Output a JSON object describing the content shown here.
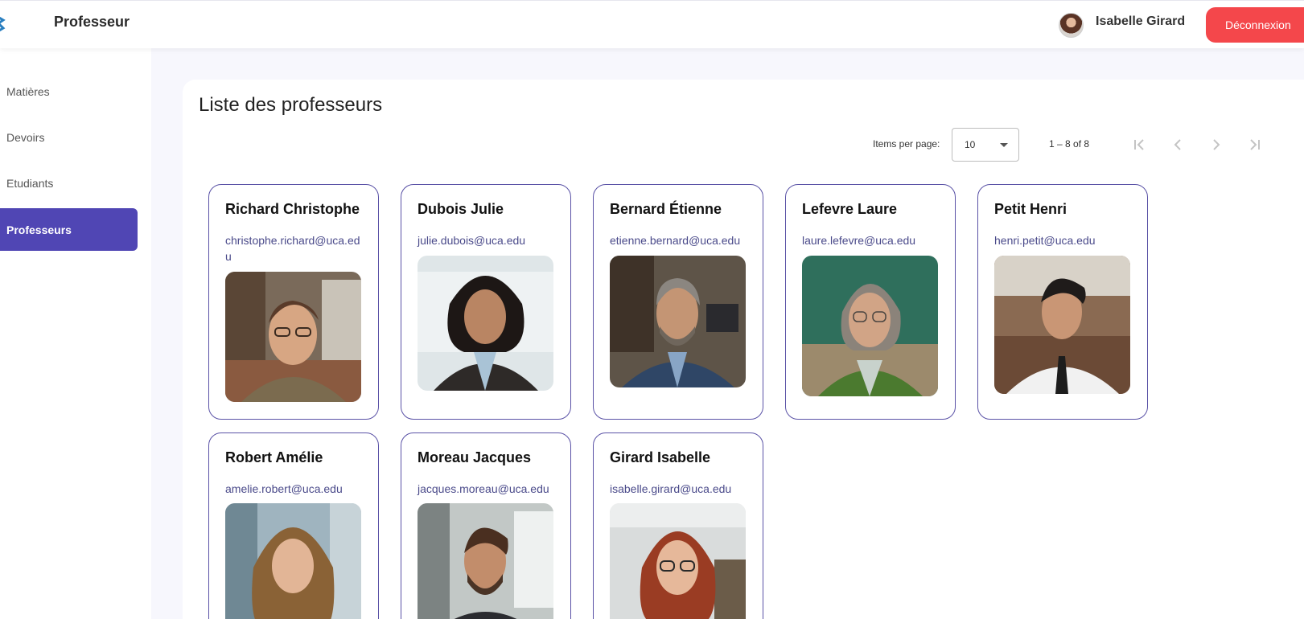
{
  "header": {
    "app_title": "Professeur",
    "user_name": "Isabelle Girard",
    "logout_label": "Déconnexion"
  },
  "sidebar": {
    "items": [
      {
        "label": "Matières",
        "active": false
      },
      {
        "label": "Devoirs",
        "active": false
      },
      {
        "label": "Etudiants",
        "active": false
      },
      {
        "label": "Professeurs",
        "active": true
      }
    ]
  },
  "main": {
    "title": "Liste des professeurs",
    "paginator": {
      "items_per_page_label": "Items per page:",
      "items_per_page_value": "10",
      "range_label": "1 – 8 of 8"
    },
    "professors": [
      {
        "name": "Richard Christophe",
        "email": "christophe.richard@uca.edu"
      },
      {
        "name": "Dubois Julie",
        "email": "julie.dubois@uca.edu"
      },
      {
        "name": "Bernard Étienne",
        "email": "etienne.bernard@uca.edu"
      },
      {
        "name": "Lefevre Laure",
        "email": "laure.lefevre@uca.edu"
      },
      {
        "name": "Petit Henri",
        "email": "henri.petit@uca.edu"
      },
      {
        "name": "Robert Amélie",
        "email": "amelie.robert@uca.edu"
      },
      {
        "name": "Moreau Jacques",
        "email": "jacques.moreau@uca.edu"
      },
      {
        "name": "Girard Isabelle",
        "email": "isabelle.girard@uca.edu"
      }
    ]
  },
  "colors": {
    "accent": "#5046b4",
    "logout": "#f4474b",
    "card_border": "#5a52a6"
  }
}
